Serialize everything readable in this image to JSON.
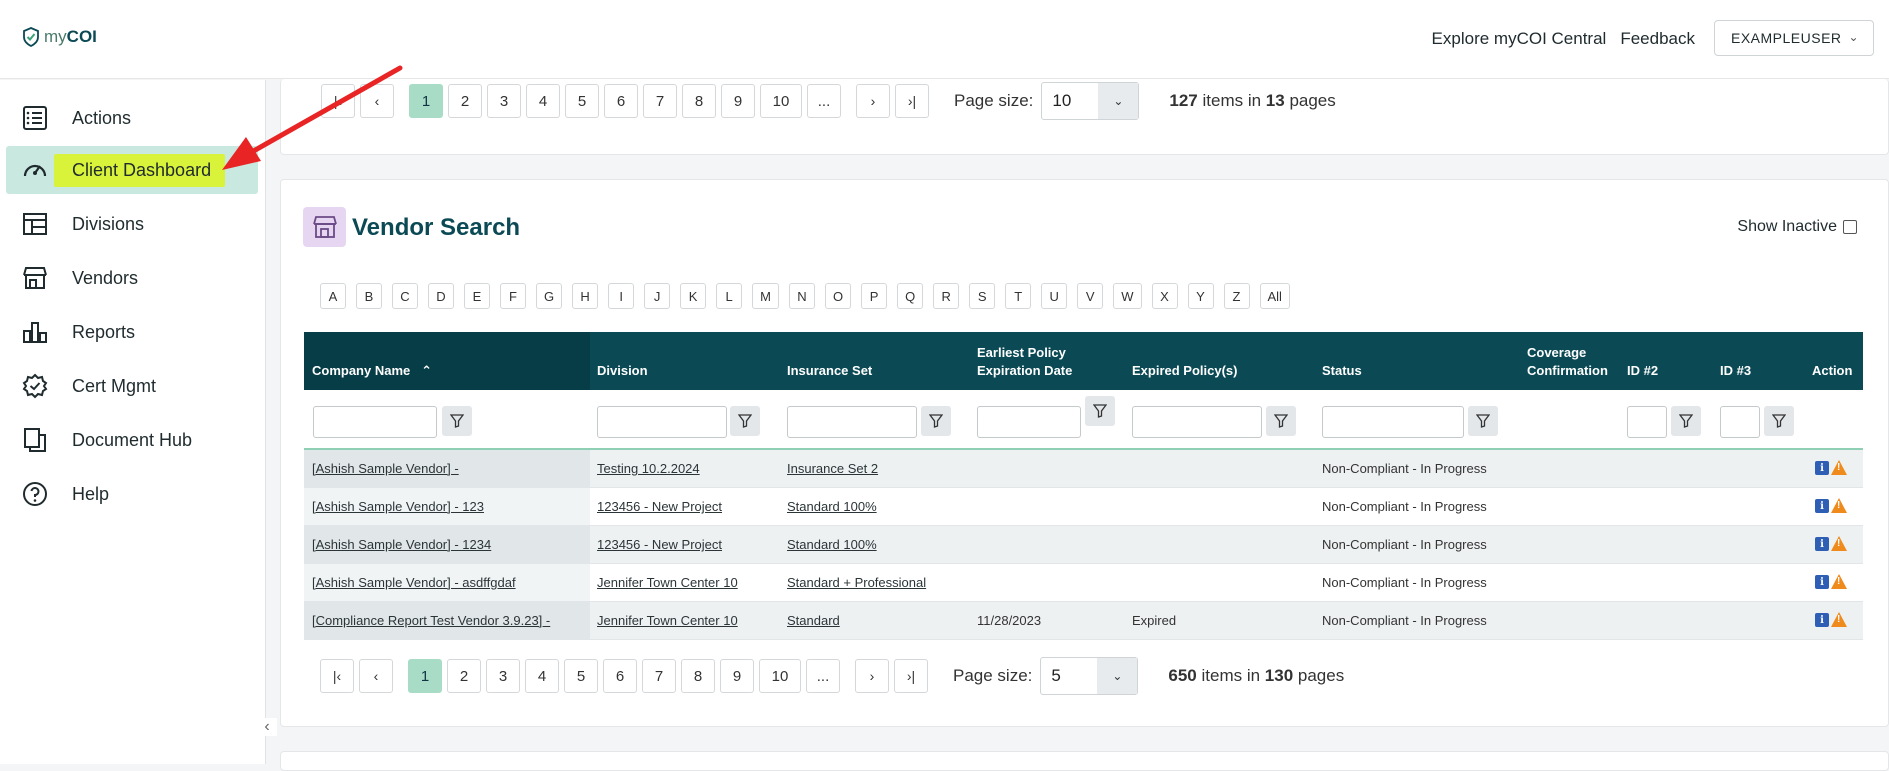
{
  "brand": {
    "logo_my": "my",
    "logo_coi": "COI"
  },
  "header": {
    "explore": "Explore myCOI Central",
    "feedback": "Feedback",
    "user": "EXAMPLEUSER"
  },
  "sidebar": {
    "items": [
      {
        "label": "Actions",
        "icon": "list-icon"
      },
      {
        "label": "Client Dashboard",
        "icon": "speedometer-icon"
      },
      {
        "label": "Divisions",
        "icon": "layout-icon"
      },
      {
        "label": "Vendors",
        "icon": "store-icon"
      },
      {
        "label": "Reports",
        "icon": "bar-chart-icon"
      },
      {
        "label": "Cert Mgmt",
        "icon": "certificate-badge-icon"
      },
      {
        "label": "Document Hub",
        "icon": "documents-icon"
      },
      {
        "label": "Help",
        "icon": "help-icon"
      }
    ]
  },
  "top_pager": {
    "pages": [
      "1",
      "2",
      "3",
      "4",
      "5",
      "6",
      "7",
      "8",
      "9",
      "10",
      "..."
    ],
    "current": "1",
    "page_size_label": "Page size:",
    "page_size": "10",
    "items": "127",
    "items_text": " items in ",
    "pages_count": "13",
    "pages_text": " pages"
  },
  "vendor_search": {
    "title": "Vendor Search",
    "show_inactive": "Show Inactive",
    "letters": [
      "A",
      "B",
      "C",
      "D",
      "E",
      "F",
      "G",
      "H",
      "I",
      "J",
      "K",
      "L",
      "M",
      "N",
      "O",
      "P",
      "Q",
      "R",
      "S",
      "T",
      "U",
      "V",
      "W",
      "X",
      "Y",
      "Z",
      "All"
    ],
    "columns": {
      "company": "Company Name",
      "division": "Division",
      "insurance_set": "Insurance Set",
      "earliest_1": "Earliest Policy",
      "earliest_2": "Expiration Date",
      "expired": "Expired Policy(s)",
      "status": "Status",
      "coverage_1": "Coverage",
      "coverage_2": "Confirmation",
      "id2": "ID #2",
      "id3": "ID #3",
      "action": "Action"
    },
    "rows": [
      {
        "company": "[Ashish Sample Vendor] -",
        "division": "Testing 10.2.2024",
        "insurance_set": "Insurance Set 2",
        "expiration": "",
        "expired": "",
        "status": "Non-Compliant - In Progress"
      },
      {
        "company": "[Ashish Sample Vendor] - 123",
        "division": "123456 - New Project",
        "insurance_set": "Standard 100%",
        "expiration": "",
        "expired": "",
        "status": "Non-Compliant - In Progress"
      },
      {
        "company": "[Ashish Sample Vendor] - 1234",
        "division": "123456 - New Project",
        "insurance_set": "Standard 100%",
        "expiration": "",
        "expired": "",
        "status": "Non-Compliant - In Progress"
      },
      {
        "company": "[Ashish Sample Vendor] - asdffgdaf",
        "division": "Jennifer Town Center 10",
        "insurance_set": "Standard + Professional",
        "expiration": "",
        "expired": "",
        "status": "Non-Compliant - In Progress"
      },
      {
        "company": "[Compliance Report Test Vendor 3.9.23] -",
        "division": "Jennifer Town Center 10",
        "insurance_set": "Standard",
        "expiration": "11/28/2023",
        "expired": "Expired",
        "status": "Non-Compliant - In Progress"
      }
    ]
  },
  "bottom_pager": {
    "pages": [
      "1",
      "2",
      "3",
      "4",
      "5",
      "6",
      "7",
      "8",
      "9",
      "10",
      "..."
    ],
    "current": "1",
    "page_size_label": "Page size:",
    "page_size": "5",
    "items": "650",
    "items_text": " items in ",
    "pages_count": "130",
    "pages_text": " pages"
  },
  "colors": {
    "header_bg": "#0b4a55",
    "accent_green": "#a8dcc6",
    "highlight": "#d9f23a",
    "arrow": "#e82424"
  }
}
